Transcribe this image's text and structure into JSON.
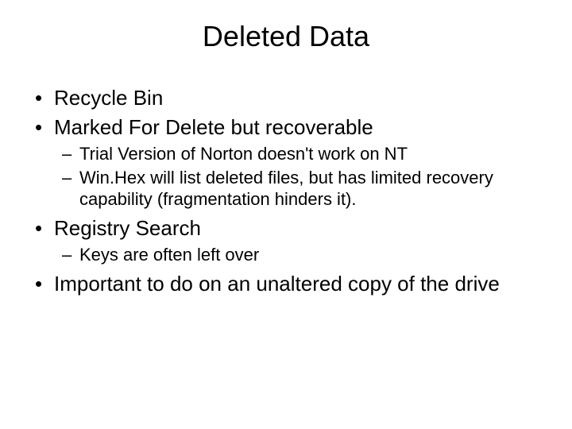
{
  "title": "Deleted Data",
  "bullets": {
    "b1": "Recycle Bin",
    "b2": "Marked For Delete but recoverable",
    "b2_sub": {
      "s1": "Trial Version of Norton doesn't work on NT",
      "s2": "Win.Hex will list deleted files, but has limited recovery capability (fragmentation hinders it)."
    },
    "b3": "Registry Search",
    "b3_sub": {
      "s1": "Keys are often left over"
    },
    "b4": "Important to do on an unaltered copy of the drive"
  }
}
